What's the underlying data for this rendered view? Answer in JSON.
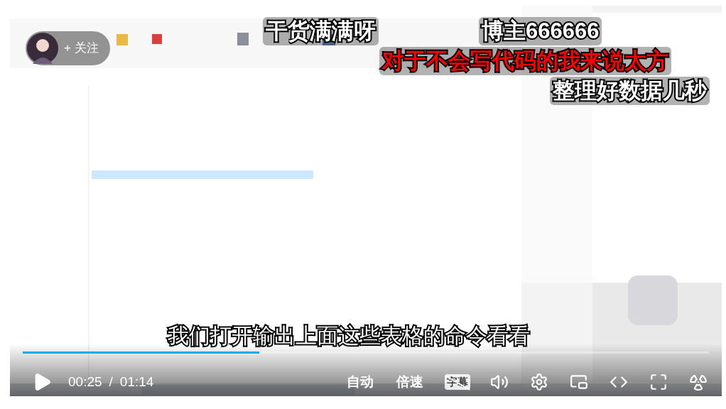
{
  "uploader": {
    "follow_label": "+ 关注"
  },
  "danmaku": [
    {
      "text": "干货满满呀",
      "color": "#ffffff"
    },
    {
      "text": "博主666666",
      "color": "#ffffff"
    },
    {
      "text": "对于不会写代码的我来说太方",
      "color": "#ff0000"
    },
    {
      "text": "整理好数据几秒",
      "color": "#ffffff"
    }
  ],
  "subtitle": "我们打开输出上面这些表格的命令看看",
  "player": {
    "playing": false,
    "current_time": "00:25",
    "separator": "/",
    "duration": "01:14",
    "level": 0.345,
    "quality": "自动",
    "speed": "倍速",
    "captions": {
      "label": "字幕",
      "on": false
    }
  }
}
